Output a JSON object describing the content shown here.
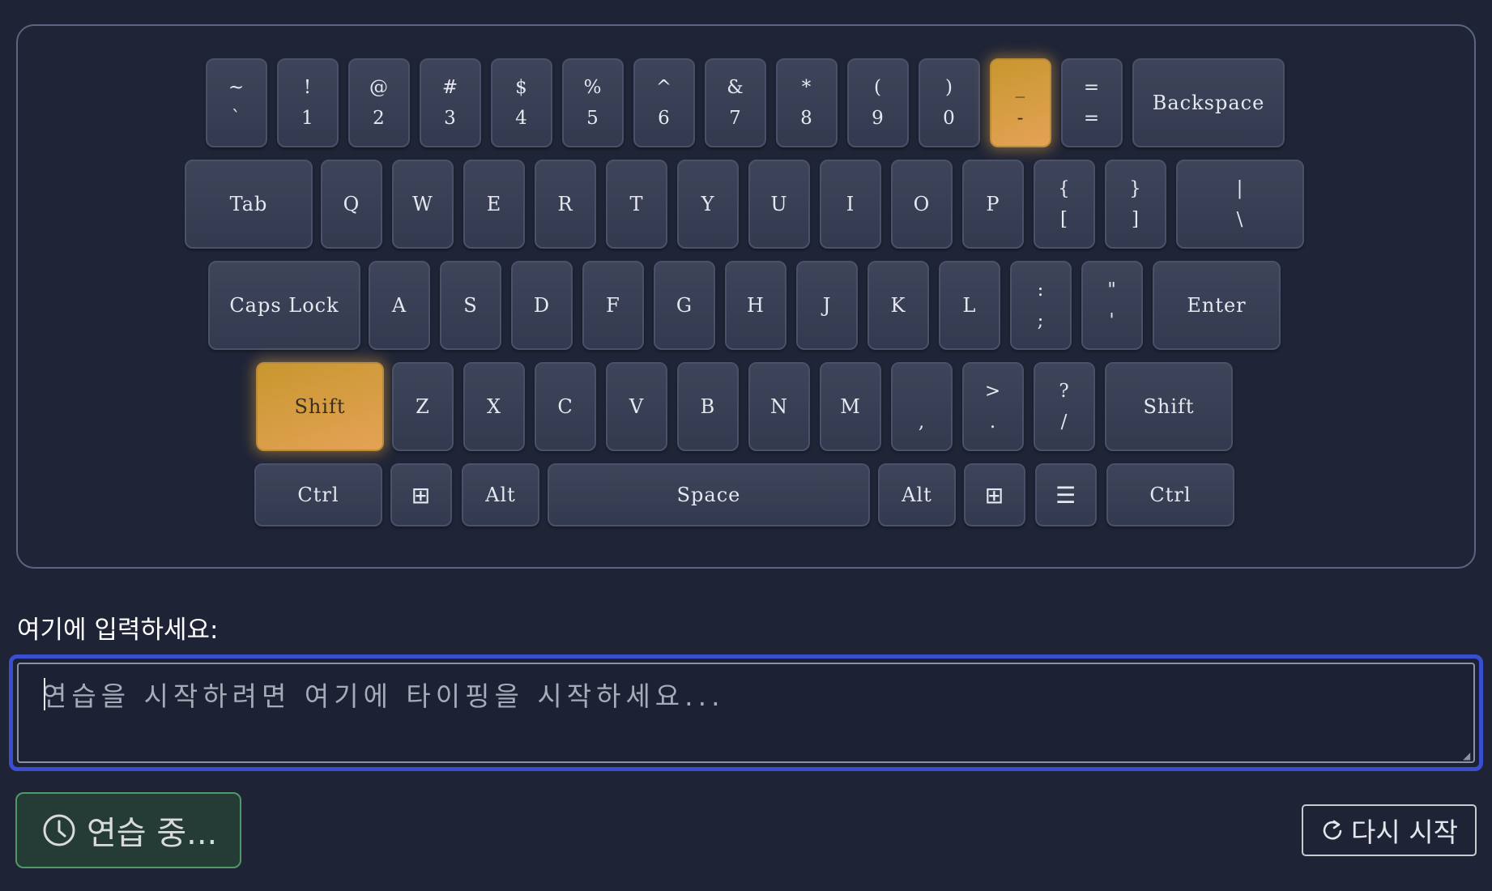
{
  "keyboard": {
    "row1": [
      {
        "top": "~",
        "bottom": "`"
      },
      {
        "top": "!",
        "bottom": "1"
      },
      {
        "top": "@",
        "bottom": "2"
      },
      {
        "top": "#",
        "bottom": "3"
      },
      {
        "top": "$",
        "bottom": "4"
      },
      {
        "top": "%",
        "bottom": "5"
      },
      {
        "top": "^",
        "bottom": "6"
      },
      {
        "top": "&",
        "bottom": "7"
      },
      {
        "top": "*",
        "bottom": "8"
      },
      {
        "top": "(",
        "bottom": "9"
      },
      {
        "top": ")",
        "bottom": "0"
      },
      {
        "top": "_",
        "bottom": "-",
        "active": true
      },
      {
        "top": "=",
        "bottom": "="
      },
      {
        "label": "Backspace"
      }
    ],
    "row2": [
      {
        "label": "Tab"
      },
      {
        "label": "Q"
      },
      {
        "label": "W"
      },
      {
        "label": "E"
      },
      {
        "label": "R"
      },
      {
        "label": "T"
      },
      {
        "label": "Y"
      },
      {
        "label": "U"
      },
      {
        "label": "I"
      },
      {
        "label": "O"
      },
      {
        "label": "P"
      },
      {
        "top": "{",
        "bottom": "["
      },
      {
        "top": "}",
        "bottom": "]"
      },
      {
        "top": "|",
        "bottom": "\\"
      }
    ],
    "row3": [
      {
        "label": "Caps Lock"
      },
      {
        "label": "A"
      },
      {
        "label": "S"
      },
      {
        "label": "D"
      },
      {
        "label": "F"
      },
      {
        "label": "G"
      },
      {
        "label": "H"
      },
      {
        "label": "J"
      },
      {
        "label": "K"
      },
      {
        "label": "L"
      },
      {
        "top": ":",
        "bottom": ";"
      },
      {
        "top": "\"",
        "bottom": "'"
      },
      {
        "label": "Enter"
      }
    ],
    "row4": [
      {
        "label": "Shift",
        "active": true
      },
      {
        "label": "Z"
      },
      {
        "label": "X"
      },
      {
        "label": "C"
      },
      {
        "label": "V"
      },
      {
        "label": "B"
      },
      {
        "label": "N"
      },
      {
        "label": "M"
      },
      {
        "top": "",
        "bottom": ","
      },
      {
        "top": ">",
        "bottom": "."
      },
      {
        "top": "?",
        "bottom": "/"
      },
      {
        "label": "Shift"
      }
    ],
    "row5": [
      {
        "label": "Ctrl"
      },
      {
        "icon": "windows-icon",
        "glyph": "⊞"
      },
      {
        "label": "Alt"
      },
      {
        "label": "Space"
      },
      {
        "label": "Alt"
      },
      {
        "icon": "windows-icon",
        "glyph": "⊞"
      },
      {
        "icon": "menu-icon",
        "glyph": "☰"
      },
      {
        "label": "Ctrl"
      }
    ]
  },
  "input": {
    "label": "여기에 입력하세요:",
    "placeholder": "연습을 시작하려면 여기에 타이핑을 시작하세요...",
    "value": ""
  },
  "status": {
    "icon": "clock-icon",
    "label": "연습 중..."
  },
  "restart": {
    "icon": "refresh-icon",
    "label": "다시 시작"
  },
  "colors": {
    "background": "#1e2336",
    "key": "#383e54",
    "active_key": "#d9a047",
    "focus_border": "#3a4ed0",
    "status_border": "#4e9a66"
  }
}
